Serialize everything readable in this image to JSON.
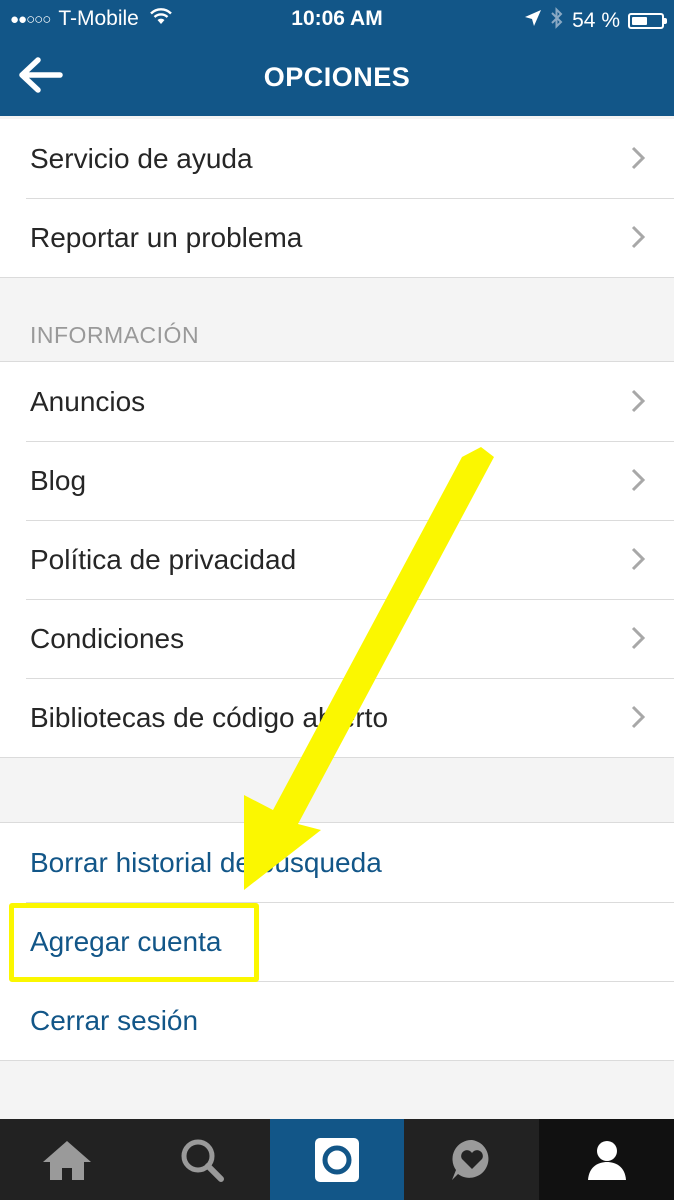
{
  "status_bar": {
    "signal_dots": "●●○○○",
    "carrier": "T-Mobile",
    "time": "10:06 AM",
    "battery_percent": "54 %",
    "battery_level": 0.54,
    "icons": [
      "wifi-icon",
      "location-arrow-icon",
      "bluetooth-icon",
      "battery-icon"
    ]
  },
  "nav": {
    "title": "OPCIONES",
    "back_icon": "back-arrow-icon"
  },
  "support_items": [
    {
      "label": "Servicio de ayuda"
    },
    {
      "label": "Reportar un problema"
    }
  ],
  "info_section": {
    "header": "INFORMACIÓN",
    "items": [
      {
        "label": "Anuncios"
      },
      {
        "label": "Blog"
      },
      {
        "label": "Política de privacidad"
      },
      {
        "label": "Condiciones"
      },
      {
        "label": "Bibliotecas de código abierto"
      }
    ]
  },
  "account_actions": [
    {
      "label": "Borrar historial de búsqueda"
    },
    {
      "label": "Agregar cuenta",
      "highlighted": true
    },
    {
      "label": "Cerrar sesión"
    }
  ],
  "colors": {
    "brand_blue": "#125688",
    "highlight_yellow": "#fbf700",
    "tabbar_dark": "#222222"
  },
  "tab_bar": {
    "tabs": [
      {
        "icon": "home-icon"
      },
      {
        "icon": "search-icon"
      },
      {
        "icon": "camera-icon",
        "active": true
      },
      {
        "icon": "activity-heart-icon"
      },
      {
        "icon": "profile-icon"
      }
    ]
  }
}
